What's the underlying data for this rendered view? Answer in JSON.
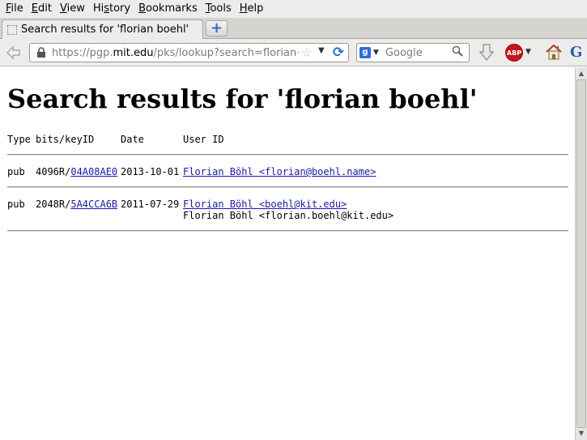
{
  "menu": {
    "items": [
      {
        "accel": "F",
        "rest": "ile"
      },
      {
        "accel": "E",
        "rest": "dit"
      },
      {
        "accel": "V",
        "rest": "iew"
      },
      {
        "accel": "",
        "pre": "Hi",
        "accel2": "s",
        "rest": "tory"
      },
      {
        "accel": "B",
        "rest": "ookmarks"
      },
      {
        "accel": "T",
        "rest": "ools"
      },
      {
        "accel": "H",
        "rest": "elp"
      }
    ]
  },
  "tab": {
    "title": "Search results for 'florian boehl'",
    "new_tab_label": "+"
  },
  "navbar": {
    "url_prefix": "https://pgp.",
    "url_host": "mit.edu",
    "url_path": "/pks/lookup?search=florian+",
    "search_engine_letter": "g",
    "search_placeholder": "Google",
    "abp_label": "ABP",
    "g_label": "G"
  },
  "page": {
    "title": "Search results for 'florian boehl'",
    "header": {
      "type": "Type",
      "bits": "bits/keyID",
      "date": "Date",
      "uid": "User ID"
    },
    "results": [
      {
        "type": "pub",
        "bits": "4096R/",
        "keyid": "04A08AE0",
        "date": "2013-10-01",
        "uid_link": "Florian Böhl <florian@boehl.name>",
        "extra_uids": []
      },
      {
        "type": "pub",
        "bits": "2048R/",
        "keyid": "5A4CCA6B",
        "date": "2011-07-29",
        "uid_link": "Florian Böhl <boehl@kit.edu>",
        "extra_uids": [
          "Florian Böhl <florian.boehl@kit.edu>"
        ]
      }
    ]
  },
  "colors": {
    "chrome_bg": "#edeceb",
    "link": "#1a1aa6",
    "abp_red": "#c7141a"
  }
}
